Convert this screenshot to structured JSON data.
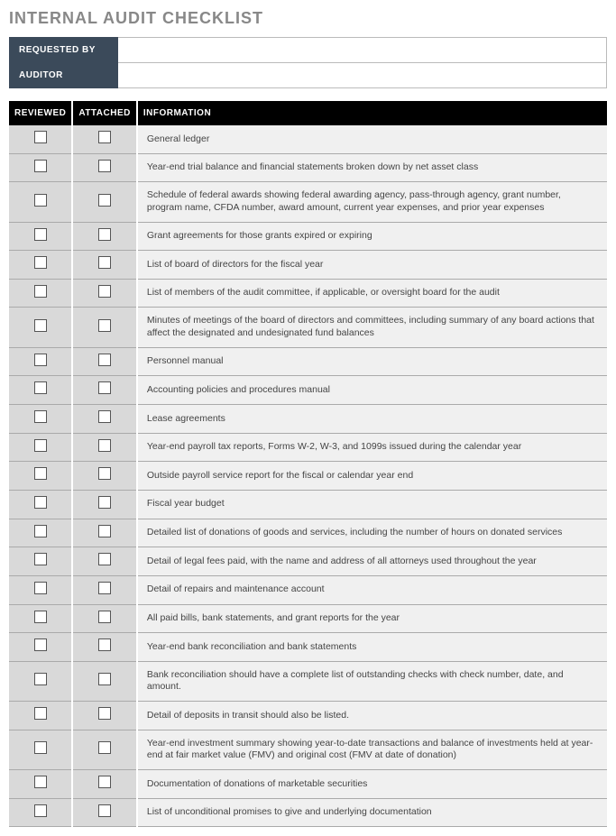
{
  "title": "INTERNAL AUDIT CHECKLIST",
  "meta": {
    "requested_by_label": "REQUESTED BY",
    "requested_by_value": "",
    "auditor_label": "AUDITOR",
    "auditor_value": ""
  },
  "columns": {
    "reviewed": "REVIEWED",
    "attached": "ATTACHED",
    "information": "INFORMATION"
  },
  "rows": [
    {
      "info": "General ledger"
    },
    {
      "info": "Year-end trial balance and financial statements broken down by net asset class"
    },
    {
      "info": "Schedule of federal awards showing federal awarding agency, pass-through agency, grant number, program name, CFDA number, award amount, current year expenses, and prior year expenses"
    },
    {
      "info": "Grant agreements for those grants expired or expiring"
    },
    {
      "info": "List of board of directors for the fiscal year"
    },
    {
      "info": "List of members of the audit committee, if applicable, or oversight board for the audit"
    },
    {
      "info": "Minutes of meetings of the board of directors and committees, including summary of any board actions that affect the designated and undesignated fund balances"
    },
    {
      "info": "Personnel manual"
    },
    {
      "info": "Accounting policies and procedures manual"
    },
    {
      "info": "Lease agreements"
    },
    {
      "info": "Year-end payroll tax reports, Forms W-2, W-3, and 1099s issued during the calendar year"
    },
    {
      "info": "Outside payroll service report for the fiscal or calendar year end"
    },
    {
      "info": "Fiscal year budget"
    },
    {
      "info": "Detailed list of donations of goods and services, including the number of hours on donated services"
    },
    {
      "info": "Detail of legal fees paid, with the name and address of all attorneys used throughout the year"
    },
    {
      "info": "Detail of repairs and maintenance account"
    },
    {
      "info": "All paid bills, bank statements, and grant reports for the year"
    },
    {
      "info": "Year-end bank reconciliation and bank statements"
    },
    {
      "info": "Bank reconciliation should have a complete list of outstanding checks with check number, date, and amount."
    },
    {
      "info": "Detail of deposits in transit should also be listed."
    },
    {
      "info": "Year-end investment summary showing year-to-date transactions and balance of investments held at year-end at fair market value (FMV) and original cost (FMV at date of donation)"
    },
    {
      "info": "Documentation of donations of marketable securities"
    },
    {
      "info": "List of unconditional promises to give and underlying documentation"
    }
  ]
}
